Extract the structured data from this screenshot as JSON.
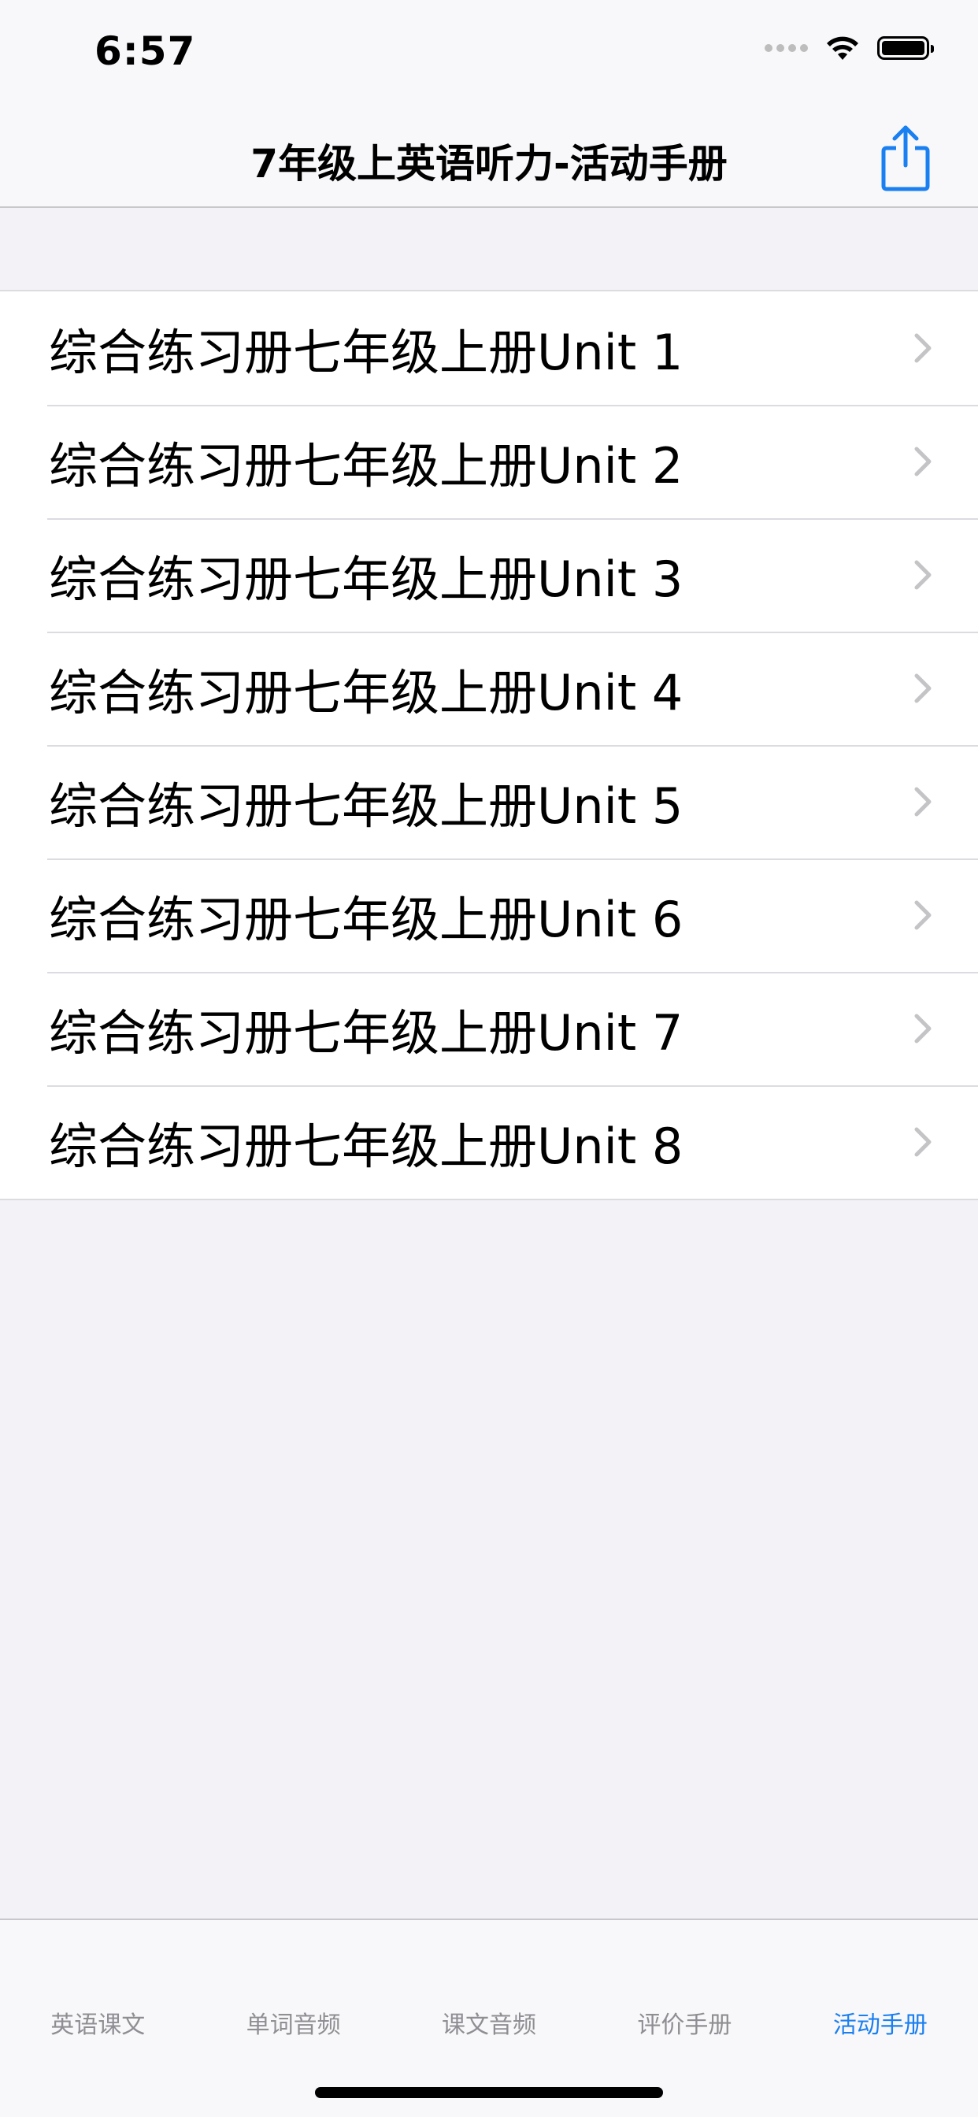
{
  "status_bar": {
    "time": "6:57"
  },
  "nav": {
    "title": "7年级上英语听力-活动手册",
    "share_icon": "share-icon"
  },
  "list": {
    "items": [
      {
        "label": "综合练习册七年级上册Unit 1"
      },
      {
        "label": "综合练习册七年级上册Unit 2"
      },
      {
        "label": "综合练习册七年级上册Unit 3"
      },
      {
        "label": "综合练习册七年级上册Unit 4"
      },
      {
        "label": "综合练习册七年级上册Unit 5"
      },
      {
        "label": "综合练习册七年级上册Unit 6"
      },
      {
        "label": "综合练习册七年级上册Unit 7"
      },
      {
        "label": "综合练习册七年级上册Unit 8"
      }
    ]
  },
  "tab_bar": {
    "tabs": [
      {
        "label": "英语课文"
      },
      {
        "label": "单词音频"
      },
      {
        "label": "课文音频"
      },
      {
        "label": "评价手册"
      },
      {
        "label": "活动手册"
      }
    ],
    "active_index": 4
  },
  "colors": {
    "accent": "#1a7ff0",
    "inactive_tab": "#8e8e93",
    "background": "#f2f2f7"
  }
}
